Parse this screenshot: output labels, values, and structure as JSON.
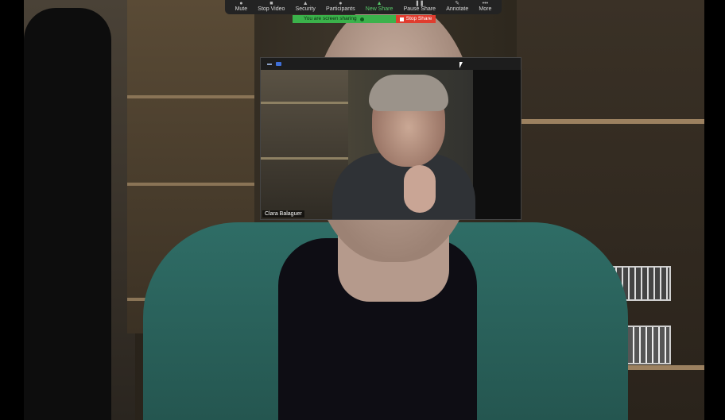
{
  "toolbar": {
    "items": [
      {
        "label": "Mute",
        "icon": "microphone-icon"
      },
      {
        "label": "Stop Video",
        "icon": "video-camera-icon"
      },
      {
        "label": "Security",
        "icon": "shield-icon"
      },
      {
        "label": "Participants",
        "icon": "participants-icon"
      },
      {
        "label": "New Share",
        "icon": "share-screen-icon"
      },
      {
        "label": "Pause Share",
        "icon": "pause-icon"
      },
      {
        "label": "Annotate",
        "icon": "pencil-icon"
      },
      {
        "label": "More",
        "icon": "more-icon"
      }
    ]
  },
  "share": {
    "notice": "You are screen sharing",
    "stop_label": "Stop Share"
  },
  "video_window": {
    "participant_name": "Clara Balaguer"
  },
  "colors": {
    "toolbar_bg": "#232323",
    "share_notice_green": "#3bb24b",
    "stop_share_red": "#e03c2e"
  }
}
